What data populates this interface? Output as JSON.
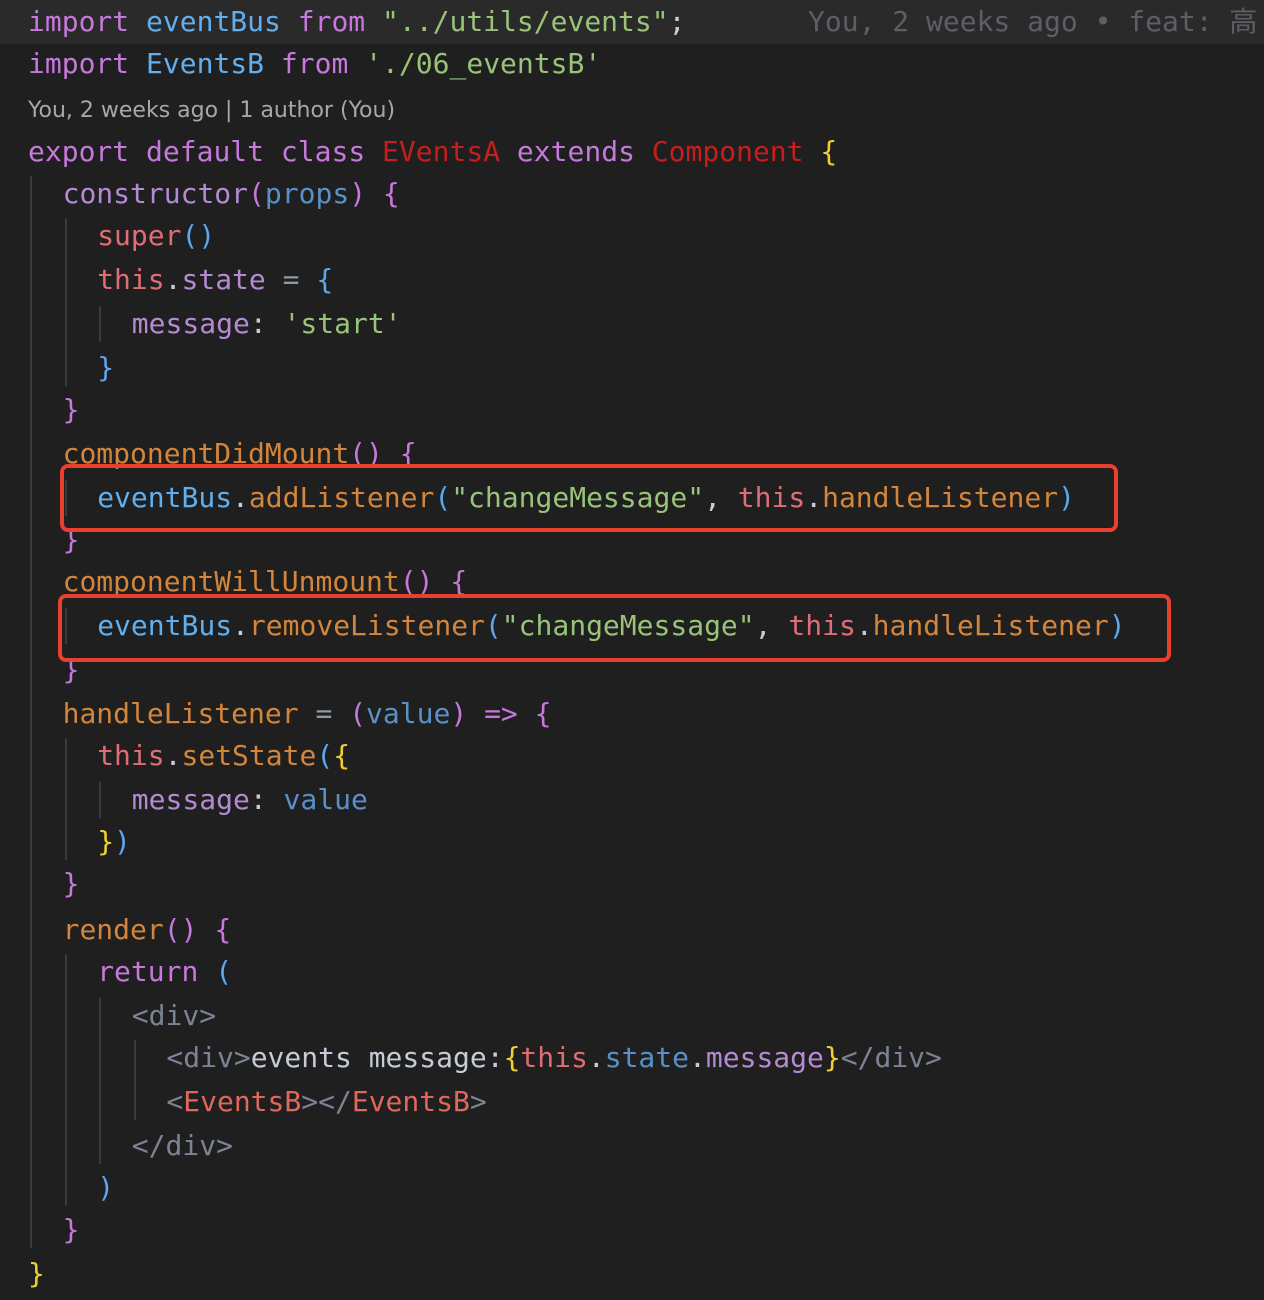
{
  "editor": {
    "blame_inline": "You, 2 weeks ago • feat: 高",
    "codelens": "You, 2 weeks ago | 1 author (You)",
    "lines": [
      [
        {
          "t": "import",
          "c": "k"
        },
        {
          "t": " ",
          "c": "p"
        },
        {
          "t": "eventBus",
          "c": "v"
        },
        {
          "t": " ",
          "c": "p"
        },
        {
          "t": "from",
          "c": "k"
        },
        {
          "t": " ",
          "c": "p"
        },
        {
          "t": "\"../utils/events\"",
          "c": "s"
        },
        {
          "t": ";",
          "c": "p"
        }
      ],
      [
        {
          "t": "import",
          "c": "k"
        },
        {
          "t": " ",
          "c": "p"
        },
        {
          "t": "EventsB",
          "c": "v"
        },
        {
          "t": " ",
          "c": "p"
        },
        {
          "t": "from",
          "c": "k"
        },
        {
          "t": " ",
          "c": "p"
        },
        {
          "t": "'./06_eventsB'",
          "c": "s"
        }
      ],
      [
        {
          "t": "export",
          "c": "k"
        },
        {
          "t": " ",
          "c": "p"
        },
        {
          "t": "default",
          "c": "k"
        },
        {
          "t": " ",
          "c": "p"
        },
        {
          "t": "class",
          "c": "k"
        },
        {
          "t": " ",
          "c": "p"
        },
        {
          "t": "EVentsA",
          "c": "cls"
        },
        {
          "t": " ",
          "c": "p"
        },
        {
          "t": "extends",
          "c": "k"
        },
        {
          "t": " ",
          "c": "p"
        },
        {
          "t": "Component",
          "c": "cls"
        },
        {
          "t": " ",
          "c": "p"
        },
        {
          "t": "{",
          "c": "by"
        }
      ],
      [
        {
          "t": "constructor",
          "c": "pr"
        },
        {
          "t": "(",
          "c": "bp"
        },
        {
          "t": "props",
          "c": "ib"
        },
        {
          "t": ")",
          "c": "bp"
        },
        {
          "t": " ",
          "c": "p"
        },
        {
          "t": "{",
          "c": "bp"
        }
      ],
      [
        {
          "t": "super",
          "c": "t"
        },
        {
          "t": "()",
          "c": "bb"
        }
      ],
      [
        {
          "t": "this",
          "c": "t"
        },
        {
          "t": ".",
          "c": "p"
        },
        {
          "t": "state",
          "c": "pr"
        },
        {
          "t": " ",
          "c": "p"
        },
        {
          "t": "=",
          "c": "o"
        },
        {
          "t": " ",
          "c": "p"
        },
        {
          "t": "{",
          "c": "bb"
        }
      ],
      [
        {
          "t": "message",
          "c": "pr"
        },
        {
          "t": ":",
          "c": "p"
        },
        {
          "t": " ",
          "c": "p"
        },
        {
          "t": "'start'",
          "c": "s"
        }
      ],
      [
        {
          "t": "}",
          "c": "bb"
        }
      ],
      [
        {
          "t": "}",
          "c": "bp"
        }
      ],
      [
        {
          "t": "componentDidMount",
          "c": "f"
        },
        {
          "t": "()",
          "c": "bp"
        },
        {
          "t": " ",
          "c": "p"
        },
        {
          "t": "{",
          "c": "bp"
        }
      ],
      [
        {
          "t": "eventBus",
          "c": "v"
        },
        {
          "t": ".",
          "c": "p"
        },
        {
          "t": "addListener",
          "c": "f"
        },
        {
          "t": "(",
          "c": "bb"
        },
        {
          "t": "\"changeMessage\"",
          "c": "s"
        },
        {
          "t": ", ",
          "c": "p"
        },
        {
          "t": "this",
          "c": "t"
        },
        {
          "t": ".",
          "c": "p"
        },
        {
          "t": "handleListener",
          "c": "f"
        },
        {
          "t": ")",
          "c": "bb"
        }
      ],
      [
        {
          "t": "}",
          "c": "bp"
        }
      ],
      [
        {
          "t": "componentWillUnmount",
          "c": "f"
        },
        {
          "t": "()",
          "c": "bp"
        },
        {
          "t": " ",
          "c": "p"
        },
        {
          "t": "{",
          "c": "bp"
        }
      ],
      [
        {
          "t": "eventBus",
          "c": "v"
        },
        {
          "t": ".",
          "c": "p"
        },
        {
          "t": "removeListener",
          "c": "f"
        },
        {
          "t": "(",
          "c": "bb"
        },
        {
          "t": "\"changeMessage\"",
          "c": "s"
        },
        {
          "t": ", ",
          "c": "p"
        },
        {
          "t": "this",
          "c": "t"
        },
        {
          "t": ".",
          "c": "p"
        },
        {
          "t": "handleListener",
          "c": "f"
        },
        {
          "t": ")",
          "c": "bb"
        }
      ],
      [
        {
          "t": "}",
          "c": "bp"
        }
      ],
      [
        {
          "t": "handleListener",
          "c": "f"
        },
        {
          "t": " ",
          "c": "p"
        },
        {
          "t": "=",
          "c": "o"
        },
        {
          "t": " ",
          "c": "p"
        },
        {
          "t": "(",
          "c": "bp"
        },
        {
          "t": "value",
          "c": "ib"
        },
        {
          "t": ")",
          "c": "bp"
        },
        {
          "t": " ",
          "c": "p"
        },
        {
          "t": "=>",
          "c": "k"
        },
        {
          "t": " ",
          "c": "p"
        },
        {
          "t": "{",
          "c": "bp"
        }
      ],
      [
        {
          "t": "this",
          "c": "t"
        },
        {
          "t": ".",
          "c": "p"
        },
        {
          "t": "setState",
          "c": "f"
        },
        {
          "t": "(",
          "c": "bb"
        },
        {
          "t": "{",
          "c": "by"
        }
      ],
      [
        {
          "t": "message",
          "c": "pr"
        },
        {
          "t": ":",
          "c": "p"
        },
        {
          "t": " ",
          "c": "p"
        },
        {
          "t": "value",
          "c": "ib"
        }
      ],
      [
        {
          "t": "}",
          "c": "by"
        },
        {
          "t": ")",
          "c": "bb"
        }
      ],
      [
        {
          "t": "}",
          "c": "bp"
        }
      ],
      [
        {
          "t": "render",
          "c": "f"
        },
        {
          "t": "()",
          "c": "bp"
        },
        {
          "t": " ",
          "c": "p"
        },
        {
          "t": "{",
          "c": "bp"
        }
      ],
      [
        {
          "t": "return",
          "c": "k"
        },
        {
          "t": " ",
          "c": "p"
        },
        {
          "t": "(",
          "c": "bb"
        }
      ],
      [
        {
          "t": "<div>",
          "c": "d"
        }
      ],
      [
        {
          "t": "<div>",
          "c": "d"
        },
        {
          "t": "events message:",
          "c": "jt"
        },
        {
          "t": "{",
          "c": "by"
        },
        {
          "t": "this",
          "c": "t"
        },
        {
          "t": ".",
          "c": "p"
        },
        {
          "t": "state",
          "c": "ib"
        },
        {
          "t": ".",
          "c": "p"
        },
        {
          "t": "message",
          "c": "pr"
        },
        {
          "t": "}",
          "c": "by"
        },
        {
          "t": "</div>",
          "c": "d"
        }
      ],
      [
        {
          "t": "<",
          "c": "d"
        },
        {
          "t": "EventsB",
          "c": "tg"
        },
        {
          "t": "></",
          "c": "d"
        },
        {
          "t": "EventsB",
          "c": "tg"
        },
        {
          "t": ">",
          "c": "d"
        }
      ],
      [
        {
          "t": "</div>",
          "c": "d"
        }
      ],
      [
        {
          "t": ")",
          "c": "bb"
        }
      ],
      [
        {
          "t": "}",
          "c": "bp"
        }
      ],
      [
        {
          "t": "}",
          "c": "by"
        }
      ]
    ]
  }
}
